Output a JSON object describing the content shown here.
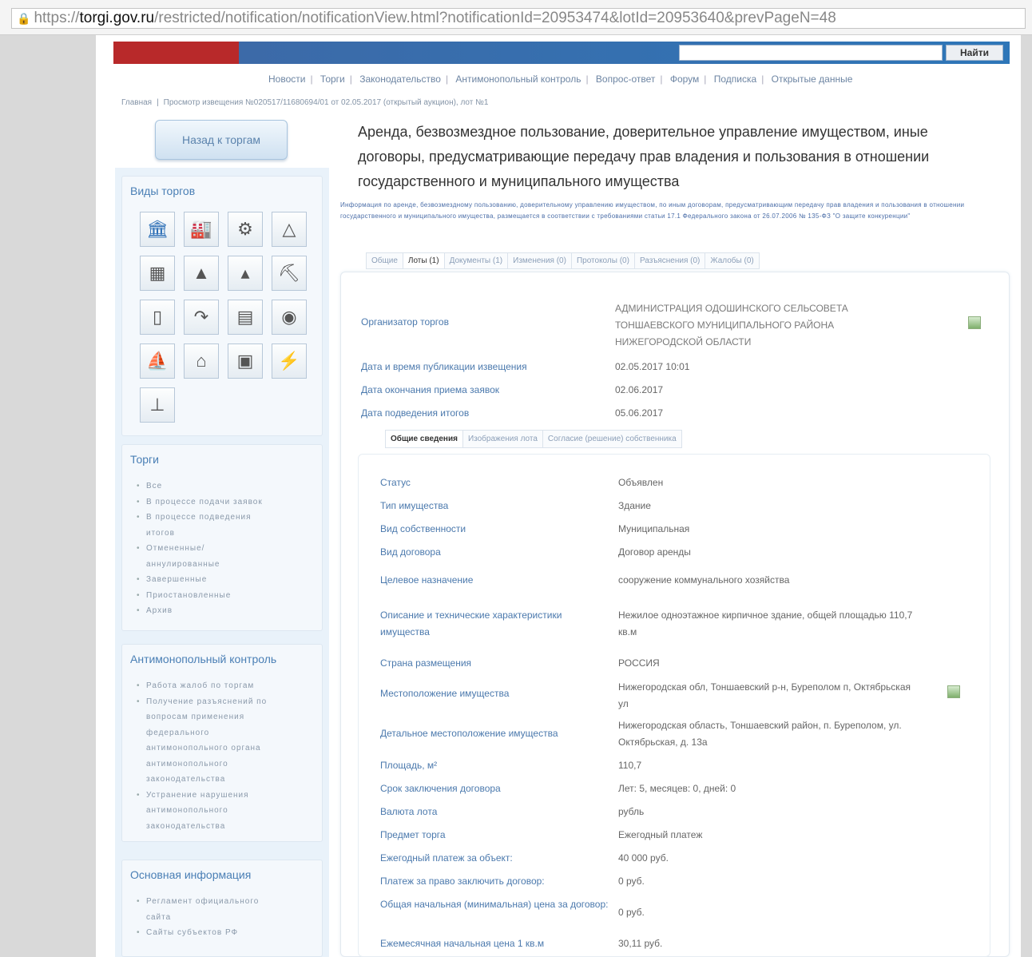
{
  "browser": {
    "url_scheme": "https://",
    "url_host": "torgi.gov.ru",
    "url_path": "/restricted/notification/notificationView.html?notificationId=20953474&lotId=20953640&prevPageN=48"
  },
  "header": {
    "search_button": "Найти",
    "nav": [
      "Новости",
      "Торги",
      "Законодательство",
      "Антимонопольный контроль",
      "Вопрос-ответ",
      "Форум",
      "Подписка",
      "Открытые данные"
    ],
    "breadcrumb": [
      "Главная",
      "Просмотр извещения №020517/11680694/01 от 02.05.2017 (открытый аукцион), лот №1"
    ]
  },
  "sidebar": {
    "back_button": "Назад к торгам",
    "types_title": "Виды торгов",
    "type_icons": [
      "bank-icon",
      "factory-icon",
      "gear-icon",
      "drilling-rig-icon",
      "construction-icon",
      "forest-icon",
      "trees-icon",
      "oil-pump-icon",
      "farm-icon",
      "pipe-icon",
      "building-icon",
      "binoculars-icon",
      "ship-icon",
      "house-icon",
      "billboard-icon",
      "power-tower-icon",
      "antenna-icon"
    ],
    "torgi_title": "Торги",
    "torgi_items": [
      "Все",
      "В процессе подачи заявок",
      "В процессе подведения итогов",
      "Отмененные/ аннулированные",
      "Завершенные",
      "Приостановленные",
      "Архив"
    ],
    "anti_title": "Антимонопольный контроль",
    "anti_items": [
      "Работа жалоб по торгам",
      "Получение разъяснений по вопросам применения федерального антимонопольного органа антимонопольного законодательства",
      "Устранение нарушения антимонопольного законодательства"
    ],
    "info_title": "Основная информация",
    "info_items": [
      "Регламент официального сайта",
      "Сайты субъектов РФ"
    ]
  },
  "main": {
    "title": "Аренда, безвозмездное пользование, доверительное управление имуществом, иные договоры, предусматривающие передачу прав владения и пользования в отношении государственного и муниципального имущества",
    "description": "Информация по аренде, безвозмездному пользованию, доверительному управлению имуществом, по иным договорам, предусматривающим передачу прав владения и пользования в отношении государственного и муниципального имущества, размещается в соответствии с требованиями статьи 17.1 Федерального закона от 26.07.2006 № 135-ФЗ \"О защите конкуренции\"",
    "tabs": [
      "Общие",
      "Лоты (1)",
      "Документы (1)",
      "Изменения (0)",
      "Протоколы (0)",
      "Разъяснения (0)",
      "Жалобы (0)"
    ],
    "fields": [
      {
        "label": "Организатор торгов",
        "value": "АДМИНИСТРАЦИЯ ОДОШИНСКОГО СЕЛЬСОВЕТА ТОНШАЕВСКОГО МУНИЦИПАЛЬНОГО РАЙОНА НИЖЕГОРОДСКОЙ ОБЛАСТИ"
      },
      {
        "label": "Дата и время публикации извещения",
        "value": "02.05.2017 10:01"
      },
      {
        "label": "Дата окончания приема заявок",
        "value": "02.06.2017"
      },
      {
        "label": "Дата подведения итогов",
        "value": "05.06.2017"
      }
    ],
    "subtabs": [
      "Общие сведения",
      "Изображения лота",
      "Согласие (решение) собственника"
    ],
    "details": [
      {
        "label": "Статус",
        "value": "Объявлен"
      },
      {
        "label": "Тип имущества",
        "value": "Здание"
      },
      {
        "label": "Вид собственности",
        "value": "Муниципальная"
      },
      {
        "label": "Вид договора",
        "value": "Договор аренды"
      },
      {
        "label": "Целевое назначение",
        "value": "сооружение коммунального хозяйства"
      },
      {
        "label": "Описание и технические характеристики имущества",
        "value": "Нежилое одноэтажное кирпичное здание, общей площадью 110,7 кв.м"
      },
      {
        "label": "Страна размещения",
        "value": "РОССИЯ"
      },
      {
        "label": "Местоположение имущества",
        "value": "Нижегородская обл, Тоншаевский р-н, Буреполом п, Октябрьская ул"
      },
      {
        "label": "Детальное местоположение имущества",
        "value": "Нижегородская область, Тоншаевский район, п. Буреполом, ул. Октябрьская, д. 13а"
      },
      {
        "label": "Площадь, м²",
        "value": "110,7"
      },
      {
        "label": "Срок заключения договора",
        "value": "Лет: 5, месяцев: 0, дней: 0"
      },
      {
        "label": "Валюта лота",
        "value": "рубль"
      },
      {
        "label": "Предмет торга",
        "value": "Ежегодный платеж"
      },
      {
        "label": "Ежегодный платеж за объект:",
        "value": "40 000 руб."
      },
      {
        "label": "Платеж за право заключить договор:",
        "value": "0 руб."
      },
      {
        "label": "Общая начальная (минимальная) цена за договор:",
        "value": "0 руб."
      },
      {
        "label": "Ежемесячная начальная цена 1 кв.м",
        "value": "30,11 руб."
      }
    ]
  }
}
